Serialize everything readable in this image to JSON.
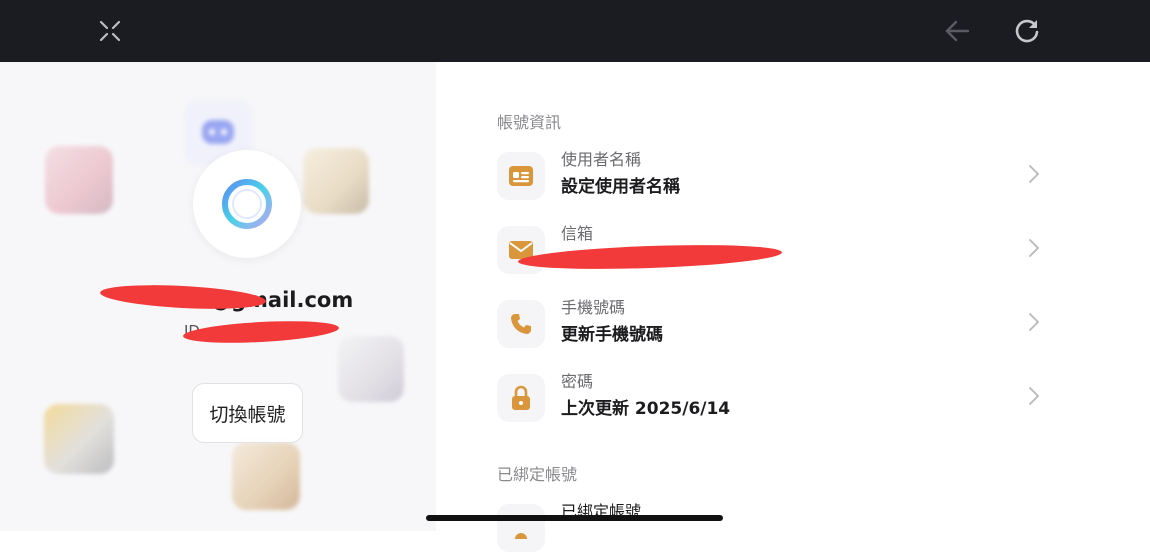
{
  "topbar": {
    "close_icon": "close-icon",
    "back_icon": "arrow-left-icon",
    "reload_icon": "reload-icon"
  },
  "profile": {
    "email": "42@gmail.com",
    "uid_prefix": "ID",
    "switch_account": "切換帳號"
  },
  "account_info": {
    "section_title": "帳號資訊",
    "items": [
      {
        "label": "使用者名稱",
        "value": "設定使用者名稱",
        "icon": "id-card-icon"
      },
      {
        "label": "信箱",
        "value": "",
        "icon": "envelope-icon"
      },
      {
        "label": "手機號碼",
        "value": "更新手機號碼",
        "icon": "phone-icon"
      },
      {
        "label": "密碼",
        "value": "上次更新 2025/6/14",
        "icon": "lock-icon"
      }
    ]
  },
  "linked_accounts": {
    "section_title": "已綁定帳號",
    "items": [
      {
        "label": "已綁定帳號"
      }
    ]
  },
  "colors": {
    "accent": "#d9963a",
    "topbar": "#1b1c22",
    "redaction": "#f23a3a"
  }
}
